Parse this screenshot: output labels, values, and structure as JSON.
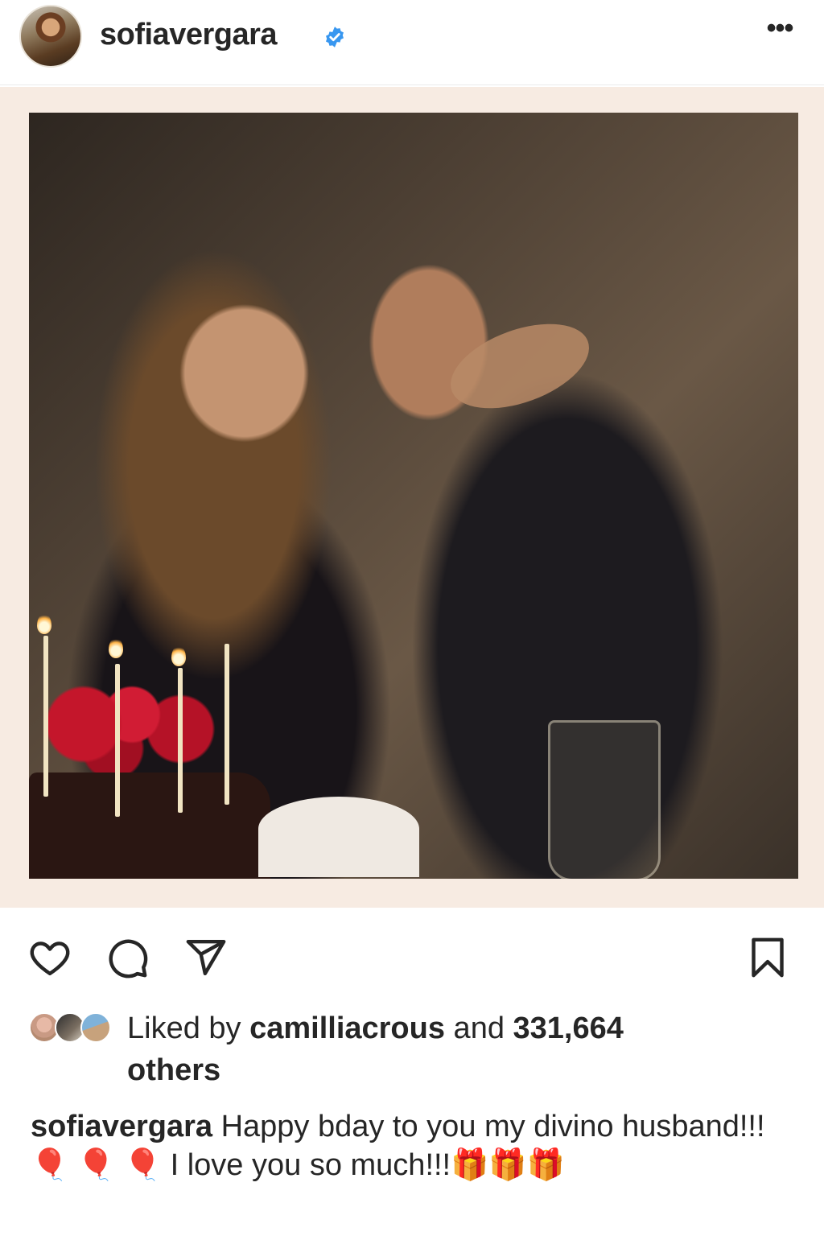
{
  "header": {
    "username": "sofiavergara",
    "verified_icon": "verified-badge-icon",
    "more_label": "•••"
  },
  "post": {
    "image_alt": "photo"
  },
  "actions": {
    "like_icon": "heart-icon",
    "comment_icon": "comment-icon",
    "share_icon": "send-icon",
    "save_icon": "bookmark-icon"
  },
  "likes": {
    "prefix": "Liked by ",
    "user": "camilliacrous",
    "middle": " and ",
    "count": "331,664",
    "suffix": "others"
  },
  "caption": {
    "username": "sofiavergara",
    "text": " Happy bday to you my divino husband!!! 🎈 🎈 🎈 I love you so much!!!🎁🎁🎁"
  },
  "colors": {
    "verified": "#3897f0",
    "text": "#262626",
    "frame": "#f7ebe2"
  }
}
